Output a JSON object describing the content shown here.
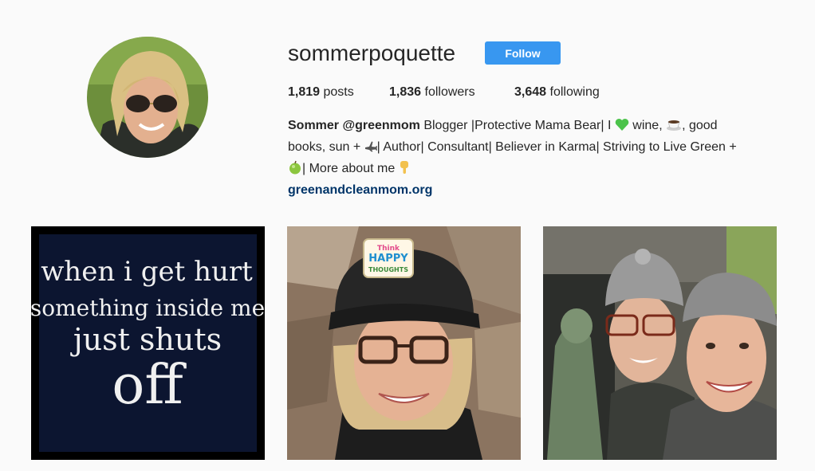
{
  "profile": {
    "username": "sommerpoquette",
    "follow_label": "Follow"
  },
  "stats": {
    "posts_count": "1,819",
    "posts_label": "posts",
    "followers_count": "1,836",
    "followers_label": "followers",
    "following_count": "3,648",
    "following_label": "following"
  },
  "bio": {
    "name": "Sommer @greenmom",
    "line1_a": " Blogger |Protective Mama Bear| I ",
    "line1_b": " wine, ",
    "line1_c": ", good",
    "line2_a": "books, sun + ",
    "line2_b": "| Author| Consultant| Believer in Karma| Striving to Live Green +",
    "line3_a": "| More about me ",
    "link": "greenandcleanmom.org",
    "icons": [
      "green-heart-icon",
      "coffee-icon",
      "airplane-icon",
      "green-apple-icon",
      "pointing-down-icon"
    ]
  },
  "posts": [
    {
      "kind": "quote-image",
      "text_lines": [
        "when i get hurt",
        "something inside me",
        "just shuts",
        "off"
      ]
    },
    {
      "kind": "selfie-photo",
      "cap_patch_lines": [
        "Think",
        "HAPPY",
        "THOUGHTS"
      ]
    },
    {
      "kind": "group-selfie-photo"
    }
  ],
  "colors": {
    "follow_button": "#3897f0",
    "link": "#003569",
    "background": "#fafafa"
  }
}
